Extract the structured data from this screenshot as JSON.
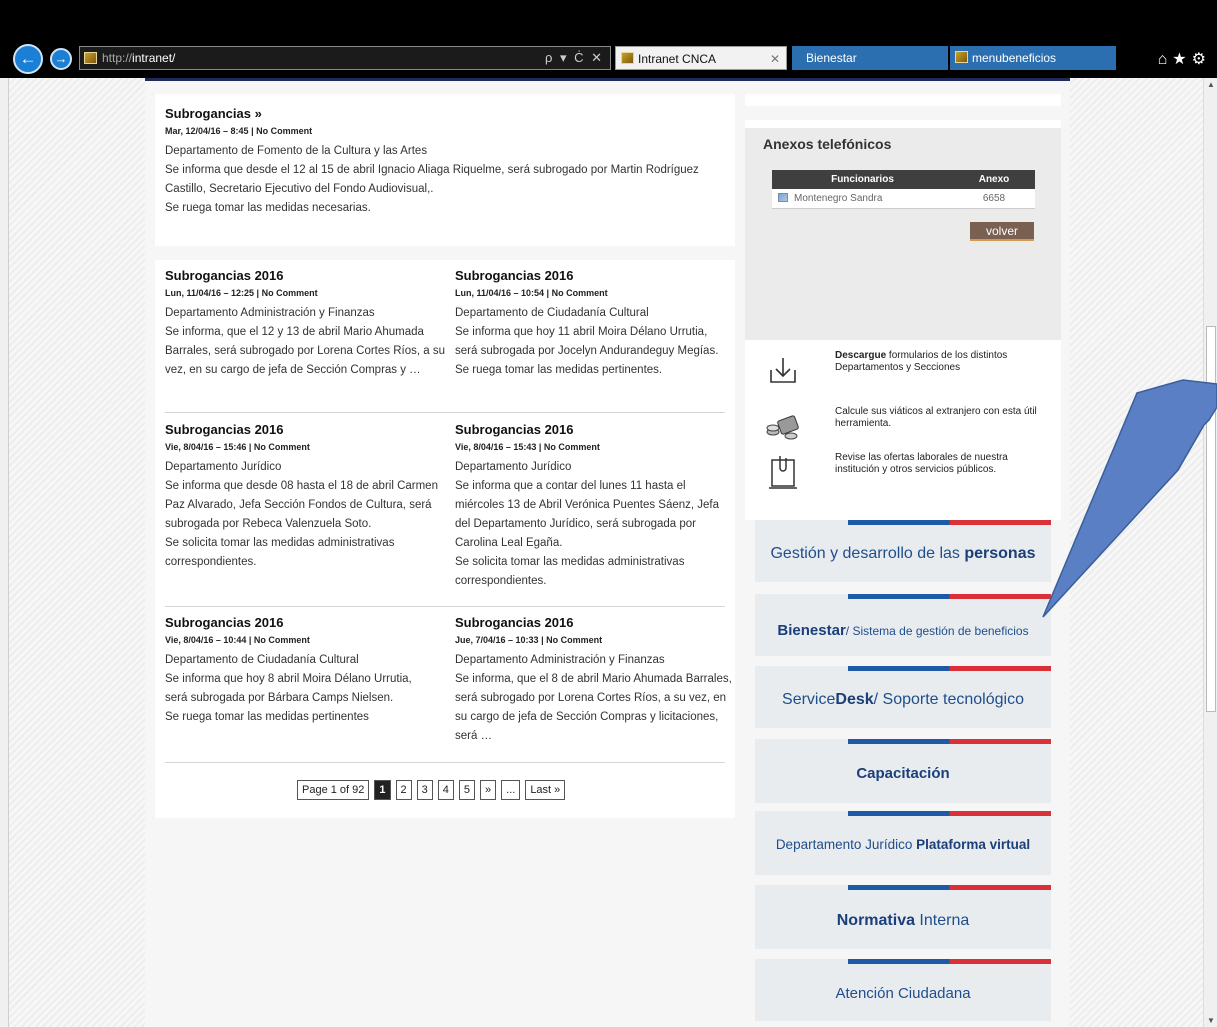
{
  "browser": {
    "address_prefix": "http://",
    "address_host": "intranet/",
    "address_tools": "ρ ▾ Ċ ✕",
    "tabs": [
      {
        "label": "Intranet CNCA",
        "active": true,
        "close": "✕"
      },
      {
        "label": "Bienestar",
        "active": false
      },
      {
        "label": "menubeneficios",
        "active": false
      }
    ],
    "right_icons": "⌂★⚙",
    "back_icon": "back-arrow-icon",
    "forward_icon": "forward-arrow-icon"
  },
  "top_post": {
    "title": "Subrogancias »",
    "meta": "Mar, 12/04/16 – 8:45 | No Comment",
    "body": [
      "Departamento de Fomento de la Cultura y las Artes",
      "Se informa que desde el 12 al 15  de abril Ignacio Aliaga Riquelme, será subrogado por Martin Rodríguez Castillo, Secretario Ejecutivo del Fondo Audiovisual,.",
      "Se ruega tomar las medidas necesarias."
    ]
  },
  "posts": [
    {
      "title": "Subrogancias 2016",
      "meta": "Lun, 11/04/16 – 12:25 | No Comment",
      "body": "Departamento Administración y Finanzas\nSe informa, que el 12 y 13 de  abril Mario Ahumada Barrales, será subrogado por Lorena Cortes Ríos, a su vez, en su cargo de jefa de Sección Compras y …"
    },
    {
      "title": "Subrogancias 2016",
      "meta": "Lun, 11/04/16 – 10:54 | No Comment",
      "body": "Departamento de Ciudadanía Cultural\nSe informa que hoy 11 abril Moira Délano Urrutia,\n será subrogada por  Jocelyn Andurandeguy Megías.\nSe ruega tomar las medidas pertinentes."
    },
    {
      "title": "Subrogancias 2016",
      "meta": "Vie, 8/04/16 – 15:46 | No Comment",
      "body": "Departamento Jurídico\nSe informa que desde 08 hasta el 18 de abril Carmen Paz Alvarado, Jefa Sección Fondos de Cultura, será subrogada por Rebeca Valenzuela Soto.\nSe solicita tomar las medidas administrativas correspondientes."
    },
    {
      "title": "Subrogancias 2016",
      "meta": "Vie, 8/04/16 – 15:43 | No Comment",
      "body": "Departamento Jurídico\nSe informa que a contar del lunes 11  hasta el miércoles 13 de Abril Verónica Puentes Sáenz, Jefa del Departamento Jurídico, será subrogada por Carolina Leal Egaña.\nSe solicita tomar las medidas administrativas correspondientes."
    },
    {
      "title": "Subrogancias 2016",
      "meta": "Vie, 8/04/16 – 10:44 | No Comment",
      "body": "Departamento de Ciudadanía Cultural\nSe informa que hoy 8 abril Moira Délano Urrutia,\n será subrogada por  Bárbara Camps Nielsen.\nSe ruega tomar las medidas pertinentes"
    },
    {
      "title": "Subrogancias 2016",
      "meta": "Jue, 7/04/16 – 10:33 | No Comment",
      "body": "Departamento Administración y Finanzas\nSe informa, que el 8 de abril Mario Ahumada Barrales, será subrogado por Lorena Cortes Ríos, a su vez, en su cargo de jefa de Sección Compras y licitaciones, será …"
    }
  ],
  "pagination": {
    "label": "Page 1 of 92",
    "pages": [
      "1",
      "2",
      "3",
      "4",
      "5",
      "»",
      "...",
      "Last »"
    ],
    "current": "1"
  },
  "anexos": {
    "title": "Anexos telefónicos",
    "col_funcionarios": "Funcionarios",
    "col_anexo": "Anexo",
    "row_name": "Montenegro Sandra",
    "row_anexo": "6658",
    "volver": "volver"
  },
  "tools": [
    {
      "icon": "download-icon",
      "bold": "Descargue",
      "text": " formularios de los distintos Departamentos y Secciones"
    },
    {
      "icon": "money-calculator-icon",
      "bold": "",
      "text": "Calcule sus viáticos al extranjero con esta útil herramienta."
    },
    {
      "icon": "clipboard-icon",
      "bold": "",
      "text": "Revise las ofertas laborales de nuestra institución y otros servicios públicos."
    }
  ],
  "menu": [
    {
      "pre": "Gestión y desarrollo de las ",
      "bold": "personas",
      "post": ""
    },
    {
      "pre": "",
      "bold": "Bienestar",
      "post": "/ Sistema de gestión de beneficios"
    },
    {
      "pre": "Service",
      "bold": "Desk",
      "post": "/ Soporte tecnológico"
    },
    {
      "pre": "",
      "bold": "Capacitación",
      "post": ""
    },
    {
      "pre": "Departamento Jurídico ",
      "bold": "Plataforma virtual",
      "post": ""
    },
    {
      "pre": "",
      "bold": "Normativa",
      "post": " Interna"
    },
    {
      "pre": "Atención Ciudadana",
      "bold": "",
      "post": ""
    }
  ],
  "colors": {
    "accent_blue": "#1f4e8c",
    "stripe_blue": "#1f5aa6",
    "stripe_red": "#d9303a",
    "callout": "#5b7fc4"
  }
}
